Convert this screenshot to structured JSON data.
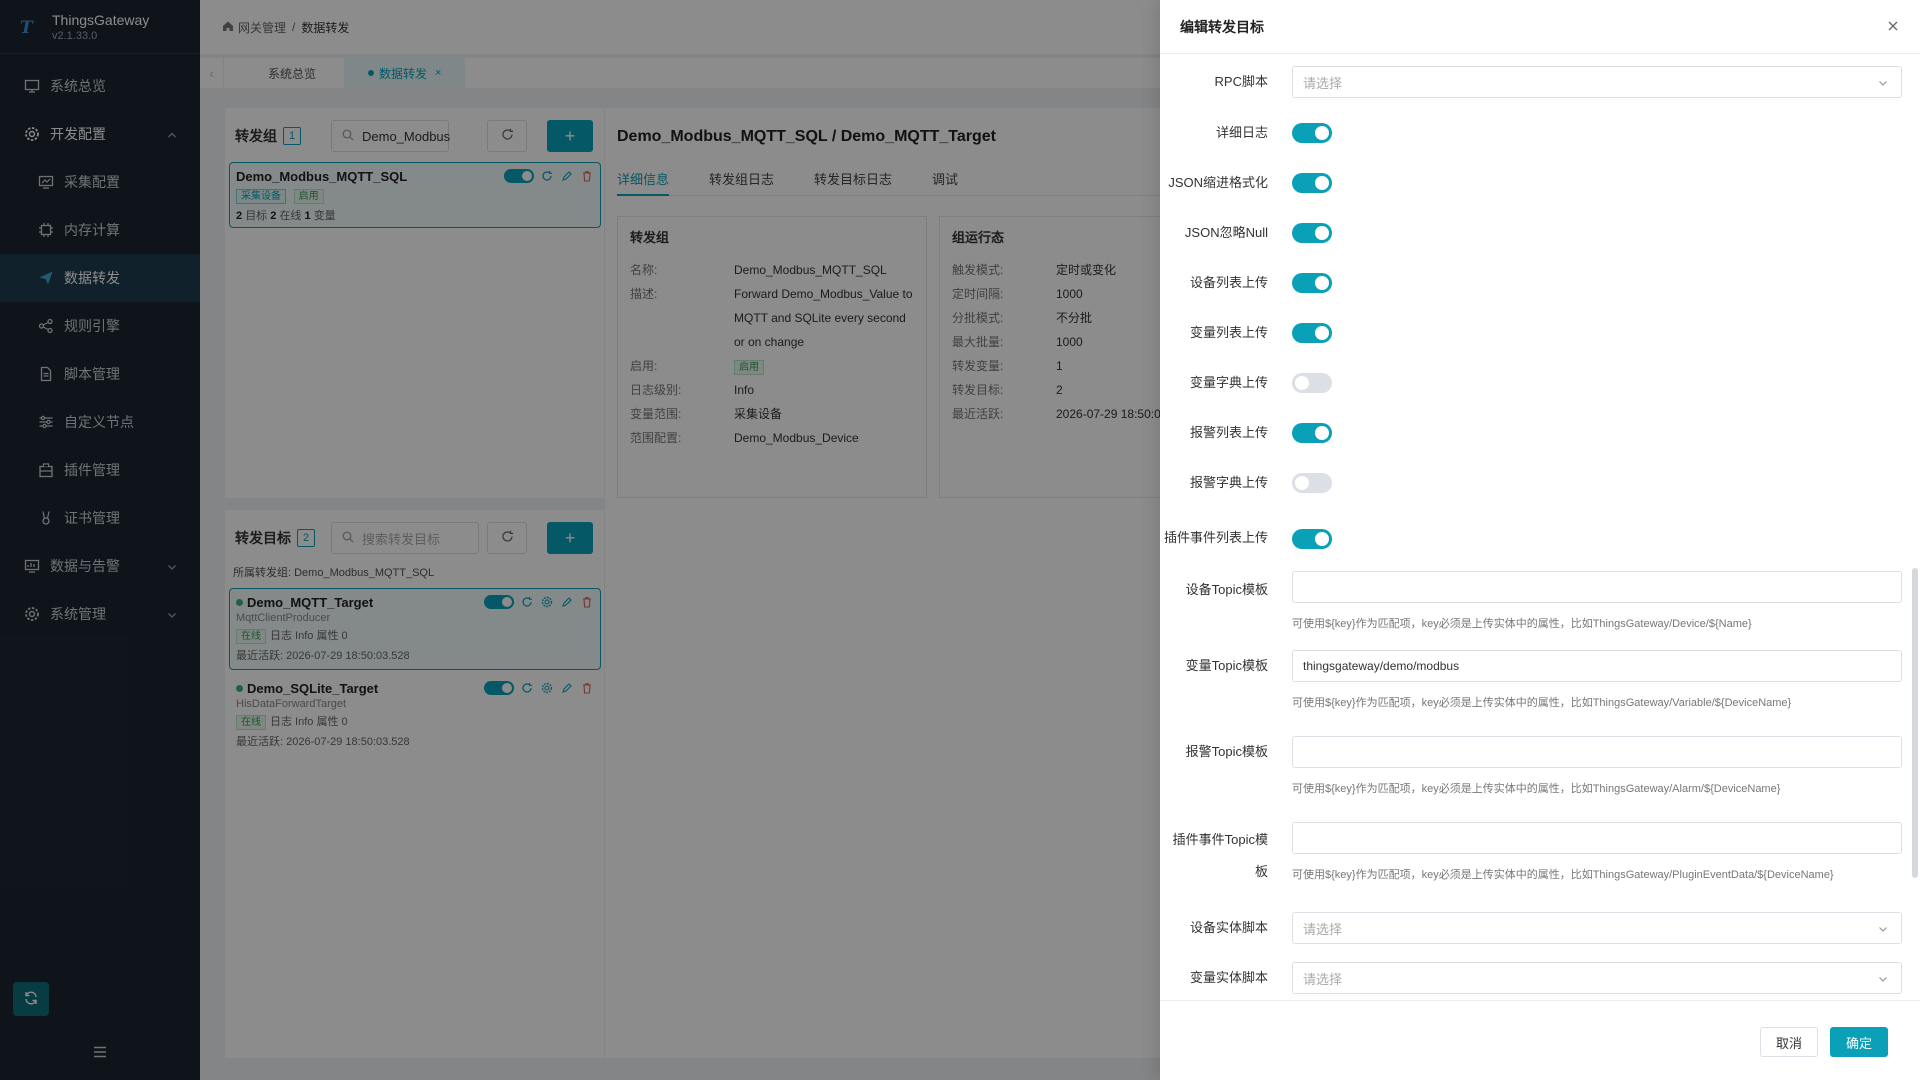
{
  "app": {
    "name": "ThingsGateway",
    "version": "v2.1.33.0"
  },
  "sidebar": {
    "items": [
      {
        "label": "系统总览",
        "icon": "monitor-icon"
      },
      {
        "label": "开发配置",
        "icon": "gear-icon",
        "expanded": true
      },
      {
        "label": "采集配置",
        "icon": "collect-icon"
      },
      {
        "label": "内存计算",
        "icon": "chip-icon"
      },
      {
        "label": "数据转发",
        "icon": "send-icon",
        "active": true
      },
      {
        "label": "规则引擎",
        "icon": "share-icon"
      },
      {
        "label": "脚本管理",
        "icon": "script-icon"
      },
      {
        "label": "自定义节点",
        "icon": "sliders-icon"
      },
      {
        "label": "插件管理",
        "icon": "plugin-icon"
      },
      {
        "label": "证书管理",
        "icon": "cert-icon"
      },
      {
        "label": "数据与告警",
        "icon": "data-alarm-icon"
      },
      {
        "label": "系统管理",
        "icon": "system-gear-icon"
      }
    ]
  },
  "breadcrumb": {
    "root": "网关管理",
    "sep": "/",
    "current": "数据转发"
  },
  "tabs": [
    {
      "label": "系统总览"
    },
    {
      "label": "数据转发",
      "close": "×"
    }
  ],
  "group_section": {
    "title": "转发组",
    "count": "1",
    "search_value": "Demo_Modbus",
    "card": {
      "name": "Demo_Modbus_MQTT_SQL",
      "tags": [
        "采集设备",
        "启用"
      ],
      "meta_targets": "2",
      "meta_targets_label": "目标",
      "meta_online": "2",
      "meta_online_label": "在线",
      "meta_vars": "1",
      "meta_vars_label": "变量"
    }
  },
  "target_section": {
    "title": "转发目标",
    "count": "2",
    "search_placeholder": "搜索转发目标",
    "group_label": "所属转发组: Demo_Modbus_MQTT_SQL",
    "cards": [
      {
        "name": "Demo_MQTT_Target",
        "type": "MqttClientProducer",
        "status": "在线",
        "meta": "日志 Info 属性 0",
        "last": "最近活跃: 2026-07-29 18:50:03.528"
      },
      {
        "name": "Demo_SQLite_Target",
        "type": "HisDataForwardTarget",
        "status": "在线",
        "meta": "日志 Info 属性 0",
        "last": "最近活跃: 2026-07-29 18:50:03.528"
      }
    ]
  },
  "detail": {
    "title": "Demo_Modbus_MQTT_SQL / Demo_MQTT_Target",
    "tabs": [
      "详细信息",
      "转发组日志",
      "转发目标日志",
      "调试"
    ],
    "group_box": {
      "heading": "转发组",
      "rows": [
        {
          "k": "名称:",
          "v": "Demo_Modbus_MQTT_SQL"
        },
        {
          "k": "描述:",
          "v": "Forward Demo_Modbus_Value to MQTT and SQLite every second or on change"
        },
        {
          "k": "启用:",
          "v": "启用"
        },
        {
          "k": "日志级别:",
          "v": "Info"
        },
        {
          "k": "变量范围:",
          "v": "采集设备"
        },
        {
          "k": "范围配置:",
          "v": "Demo_Modbus_Device"
        }
      ]
    },
    "run_box": {
      "heading": "组运行态",
      "rows": [
        {
          "k": "触发模式:",
          "v": "定时或变化"
        },
        {
          "k": "定时间隔:",
          "v": "1000"
        },
        {
          "k": "分批模式:",
          "v": "不分批"
        },
        {
          "k": "最大批量:",
          "v": "1000"
        },
        {
          "k": "转发变量:",
          "v": "1"
        },
        {
          "k": "转发目标:",
          "v": "2"
        },
        {
          "k": "最近活跃:",
          "v": "2026-07-29 18:50:0"
        }
      ]
    }
  },
  "drawer": {
    "title": "编辑转发目标",
    "fields": {
      "rpc_script": {
        "label": "RPC脚本",
        "placeholder": "请选择"
      },
      "detail_log": {
        "label": "详细日志",
        "on": true
      },
      "json_indent": {
        "label": "JSON缩进格式化",
        "on": true
      },
      "json_ignore_null": {
        "label": "JSON忽略Null",
        "on": true
      },
      "device_list_upload": {
        "label": "设备列表上传",
        "on": true
      },
      "variable_list_upload": {
        "label": "变量列表上传",
        "on": true
      },
      "variable_dict_upload": {
        "label": "变量字典上传",
        "on": false
      },
      "alarm_list_upload": {
        "label": "报警列表上传",
        "on": true
      },
      "alarm_dict_upload": {
        "label": "报警字典上传",
        "on": false
      },
      "plugin_event_list_upload": {
        "label": "插件事件列表上传",
        "on": true
      },
      "device_topic": {
        "label": "设备Topic模板",
        "value": "",
        "hint": "可使用${key}作为匹配项，key必须是上传实体中的属性，比如ThingsGateway/Device/${Name}"
      },
      "variable_topic": {
        "label": "变量Topic模板",
        "value": "thingsgateway/demo/modbus",
        "hint": "可使用${key}作为匹配项，key必须是上传实体中的属性，比如ThingsGateway/Variable/${DeviceName}"
      },
      "alarm_topic": {
        "label": "报警Topic模板",
        "value": "",
        "hint": "可使用${key}作为匹配项，key必须是上传实体中的属性，比如ThingsGateway/Alarm/${DeviceName}"
      },
      "plugin_event_topic": {
        "label": "插件事件Topic模板",
        "value": "",
        "hint": "可使用${key}作为匹配项，key必须是上传实体中的属性，比如ThingsGateway/PluginEventData/${DeviceName}"
      },
      "device_entity_script": {
        "label": "设备实体脚本",
        "placeholder": "请选择"
      },
      "variable_entity_script": {
        "label": "变量实体脚本",
        "placeholder": "请选择"
      }
    },
    "cancel": "取消",
    "ok": "确定"
  },
  "colors": {
    "accent": "#0aa1b8",
    "sidebar": "#1d2631"
  }
}
